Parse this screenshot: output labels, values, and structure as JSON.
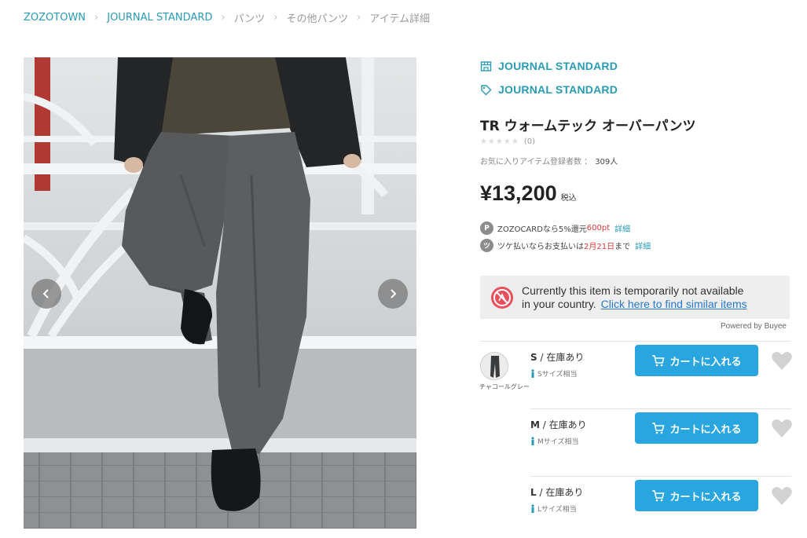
{
  "breadcrumb": [
    "ZOZOTOWN",
    "JOURNAL STANDARD",
    "パンツ",
    "その他パンツ",
    "アイテム詳細"
  ],
  "brand": {
    "shop_name": "JOURNAL STANDARD",
    "brand_name": "JOURNAL STANDARD"
  },
  "product": {
    "title": "TR ウォームテック オーバーパンツ",
    "stars": "★★★★★",
    "review_count": "(0)",
    "favorites_label": "お気に入りアイテム登録者数 ：",
    "favorites_count": "309人",
    "price": "¥13,200",
    "tax_label": "税込"
  },
  "promos": {
    "zozocard": {
      "badge": "P",
      "text_prefix": "ZOZOCARDなら5%還元",
      "points": "600pt",
      "link": "詳細"
    },
    "tsuke": {
      "badge": "ツ",
      "text_prefix": "ツケ払いならお支払いは",
      "date": "2月21日",
      "text_suffix": "まで",
      "link": "詳細"
    }
  },
  "availability": {
    "line1": "Currently this item is temporarily not available",
    "line2": "in your country.",
    "link": "Click here to find similar items",
    "powered_by": "Powered by Buyee"
  },
  "color": {
    "name": "チャコールグレー"
  },
  "sizes": [
    {
      "size": "S",
      "stock": "在庫あり",
      "fit": "Sサイズ相当",
      "cart_label": "カートに入れる"
    },
    {
      "size": "M",
      "stock": "在庫あり",
      "fit": "Mサイズ相当",
      "cart_label": "カートに入れる"
    },
    {
      "size": "L",
      "stock": "在庫あり",
      "fit": "Lサイズ相当",
      "cart_label": "カートに入れる"
    }
  ],
  "colors": {
    "accent": "#2a9bb4",
    "cart_button": "#29a6e0",
    "price_highlight": "#d93a3a"
  }
}
